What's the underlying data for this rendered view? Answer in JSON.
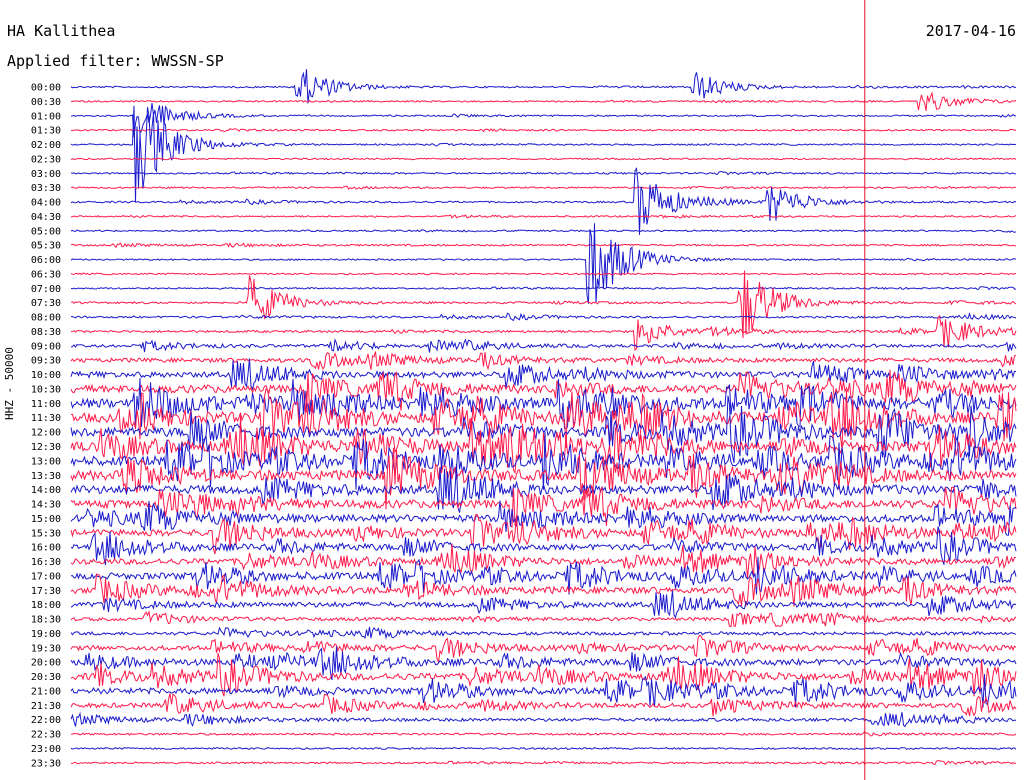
{
  "header": {
    "station": "HA Kallithea",
    "date": "2017-04-16",
    "filter": "Applied filter: WWSSN-SP"
  },
  "chart_data": {
    "type": "line",
    "title": "HA Kallithea",
    "ylabel": "HHZ - 50000",
    "rows": [
      "00:00",
      "00:30",
      "01:00",
      "01:30",
      "02:00",
      "02:30",
      "03:00",
      "03:30",
      "04:00",
      "04:30",
      "05:00",
      "05:30",
      "06:00",
      "06:30",
      "07:00",
      "07:30",
      "08:00",
      "08:30",
      "09:00",
      "09:30",
      "10:00",
      "10:30",
      "11:00",
      "11:30",
      "12:00",
      "12:30",
      "13:00",
      "13:30",
      "14:00",
      "14:30",
      "15:00",
      "15:30",
      "16:00",
      "16:30",
      "17:00",
      "17:30",
      "18:00",
      "18:30",
      "19:00",
      "19:30",
      "20:00",
      "20:30",
      "21:00",
      "21:30",
      "22:00",
      "22:30",
      "23:00",
      "23:30"
    ],
    "trace_colors": [
      "#1a1acc",
      "#ff1a4a"
    ],
    "time_marker_color": "#e0102a",
    "time_marker_fraction": 0.84,
    "row_activity": [
      0.2,
      0.2,
      0.2,
      0.2,
      0.2,
      0.2,
      0.2,
      0.2,
      0.25,
      0.2,
      0.2,
      0.25,
      0.2,
      0.2,
      0.2,
      0.3,
      0.3,
      0.35,
      0.45,
      0.6,
      0.75,
      0.9,
      1.0,
      1.0,
      1.0,
      1.0,
      1.0,
      1.0,
      0.95,
      0.9,
      0.85,
      0.8,
      0.75,
      0.75,
      0.8,
      0.8,
      0.7,
      0.5,
      0.5,
      0.65,
      0.75,
      0.8,
      0.75,
      0.65,
      0.5,
      0.3,
      0.25,
      0.25
    ],
    "events": [
      {
        "row": 0,
        "pos": 0.24,
        "amp": 1.3
      },
      {
        "row": 0,
        "pos": 0.66,
        "amp": 0.9
      },
      {
        "row": 1,
        "pos": 0.9,
        "amp": 0.7
      },
      {
        "row": 2,
        "pos": 0.07,
        "amp": 1.4
      },
      {
        "row": 4,
        "pos": 0.07,
        "amp": 3.2
      },
      {
        "row": 8,
        "pos": 0.6,
        "amp": 2.0
      },
      {
        "row": 8,
        "pos": 0.74,
        "amp": 1.2
      },
      {
        "row": 12,
        "pos": 0.55,
        "amp": 3.0
      },
      {
        "row": 15,
        "pos": 0.19,
        "amp": 1.5
      },
      {
        "row": 15,
        "pos": 0.71,
        "amp": 2.4
      },
      {
        "row": 17,
        "pos": 0.6,
        "amp": 1.0
      },
      {
        "row": 17,
        "pos": 0.92,
        "amp": 0.9
      }
    ]
  }
}
